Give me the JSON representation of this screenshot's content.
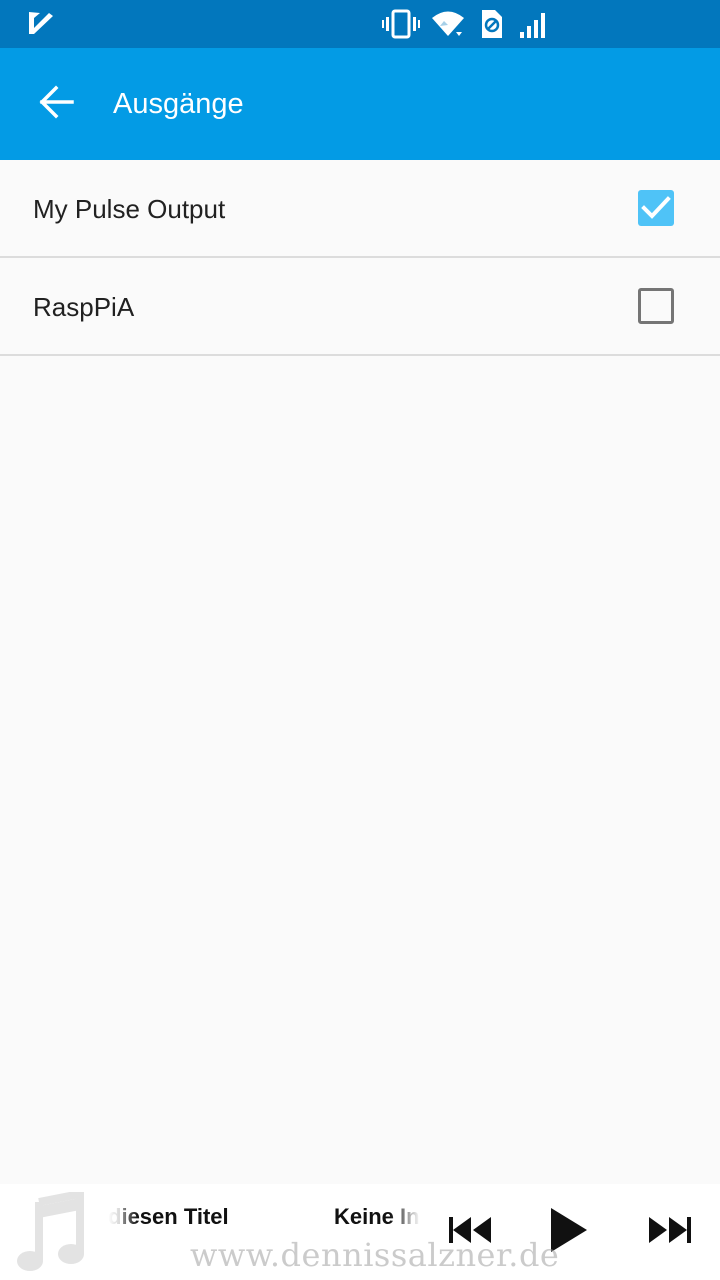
{
  "status_bar": {
    "icons": [
      "notification-check-icon",
      "vibrate-icon",
      "wifi-icon",
      "sim-icon",
      "signal-icon"
    ],
    "background": "#0277bd"
  },
  "app_bar": {
    "title": "Ausgänge",
    "back_icon": "arrow-back-icon",
    "background": "#039be5"
  },
  "outputs": [
    {
      "label": "My Pulse Output",
      "checked": true
    },
    {
      "label": "RaspPiA",
      "checked": false
    }
  ],
  "player": {
    "icon": "music-note-icon",
    "track_title": "iesen Titel",
    "track_title_prefix": "d",
    "artist": "Keine In",
    "controls": [
      "previous-icon",
      "play-icon",
      "next-icon"
    ]
  },
  "watermark": "www.dennissalzner.de",
  "colors": {
    "accent": "#4fc3f7",
    "divider": "#dcdcdc"
  }
}
